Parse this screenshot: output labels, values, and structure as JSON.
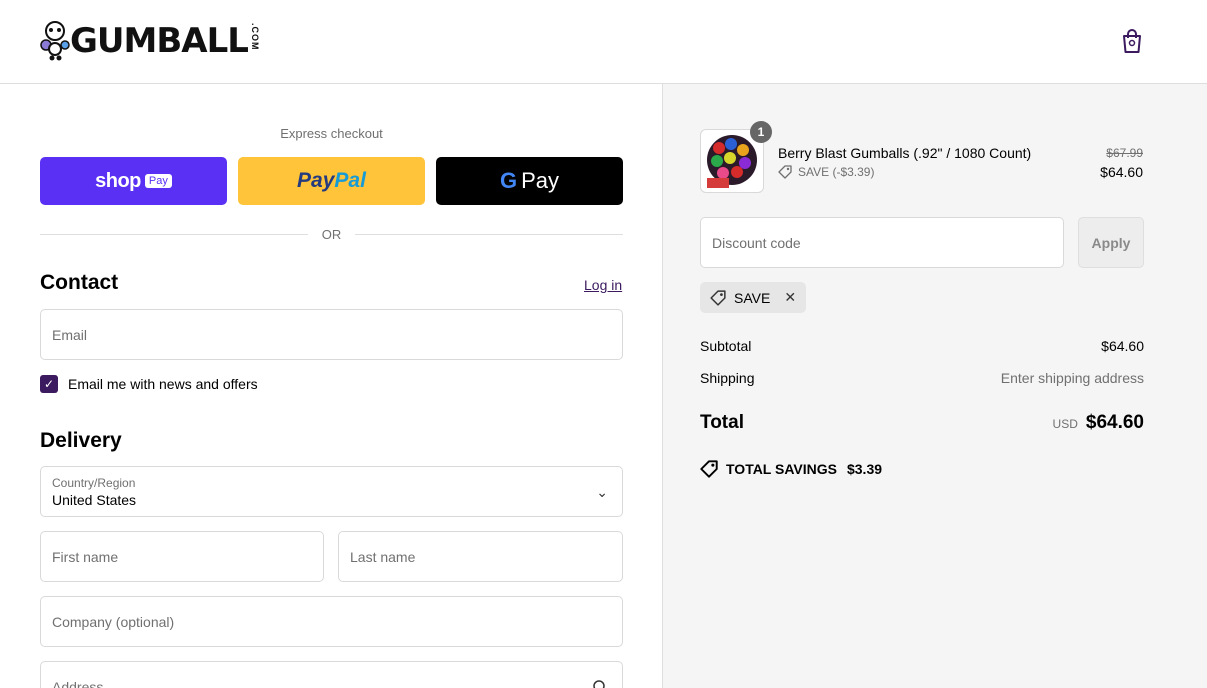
{
  "header": {
    "logo_text": "GUMBALL",
    "logo_suffix": ".COM",
    "cart_icon": "shopping-bag-icon"
  },
  "express": {
    "title": "Express checkout",
    "shop_word": "shop",
    "shop_badge": "Pay",
    "paypal_a": "Pay",
    "paypal_b": "Pal",
    "gpay_g": "G",
    "gpay_word": "Pay",
    "or_text": "OR"
  },
  "contact": {
    "title": "Contact",
    "login_label": "Log in",
    "email_placeholder": "Email",
    "newsletter_label": "Email me with news and offers",
    "newsletter_checked": true
  },
  "delivery": {
    "title": "Delivery",
    "country_label": "Country/Region",
    "country_value": "United States",
    "first_name_placeholder": "First name",
    "last_name_placeholder": "Last name",
    "company_placeholder": "Company (optional)",
    "address_placeholder": "Address"
  },
  "order": {
    "item": {
      "name": "Berry Blast Gumballs (.92\" / 1080 Count)",
      "quantity": "1",
      "discount_label": "SAVE (-$3.39)",
      "original_price": "$67.99",
      "price": "$64.60"
    },
    "discount_placeholder": "Discount code",
    "apply_label": "Apply",
    "applied_code": "SAVE",
    "subtotal_label": "Subtotal",
    "subtotal_value": "$64.60",
    "shipping_label": "Shipping",
    "shipping_value": "Enter shipping address",
    "total_label": "Total",
    "currency": "USD",
    "total_value": "$64.60",
    "savings_label": "TOTAL SAVINGS",
    "savings_value": "$3.39"
  },
  "colors": {
    "accent": "#3b1a5f",
    "shop_pay": "#5a31f4",
    "paypal": "#ffc439",
    "gpay": "#000000"
  }
}
